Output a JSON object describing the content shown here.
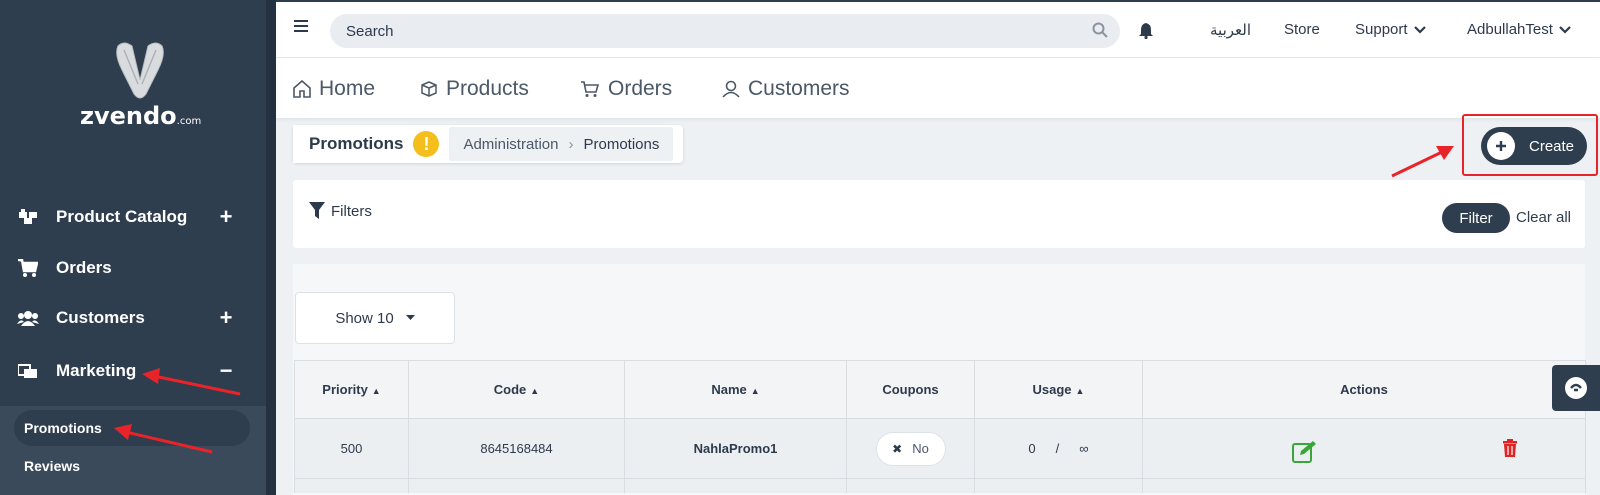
{
  "brand": {
    "name": "zvendo",
    "suffix": ".com"
  },
  "sidebar": {
    "items": [
      {
        "label": "Product Catalog",
        "toggle": "+"
      },
      {
        "label": "Orders",
        "toggle": ""
      },
      {
        "label": "Customers",
        "toggle": "+"
      },
      {
        "label": "Marketing",
        "toggle": "−"
      }
    ],
    "submenu": [
      {
        "label": "Promotions",
        "active": true
      },
      {
        "label": "Reviews",
        "active": false
      }
    ]
  },
  "topbar": {
    "search_placeholder": "Search",
    "language": "العربية",
    "store": "Store",
    "support": "Support",
    "user": "AdbullahTest"
  },
  "tabs": [
    "Home",
    "Products",
    "Orders",
    "Customers"
  ],
  "breadcrumb": {
    "title": "Promotions",
    "path": [
      "Administration",
      "Promotions"
    ]
  },
  "create_label": "Create",
  "filters": {
    "label": "Filters",
    "filter_button": "Filter",
    "clear_label": "Clear all"
  },
  "show_select": "Show 10",
  "table": {
    "columns": [
      "Priority",
      "Code",
      "Name",
      "Coupons",
      "Usage",
      "Actions"
    ],
    "rows": [
      {
        "priority": "500",
        "code": "8645168484",
        "name": "NahlaPromo1",
        "coupons": "No",
        "usage_used": "0",
        "usage_sep": "/",
        "usage_limit": "∞"
      }
    ]
  },
  "colors": {
    "sidebar": "#2f3e4e",
    "accent_red": "#e8242a",
    "edit_green": "#3aa63a",
    "delete_red": "#e02424",
    "warning": "#f4bf1c"
  }
}
